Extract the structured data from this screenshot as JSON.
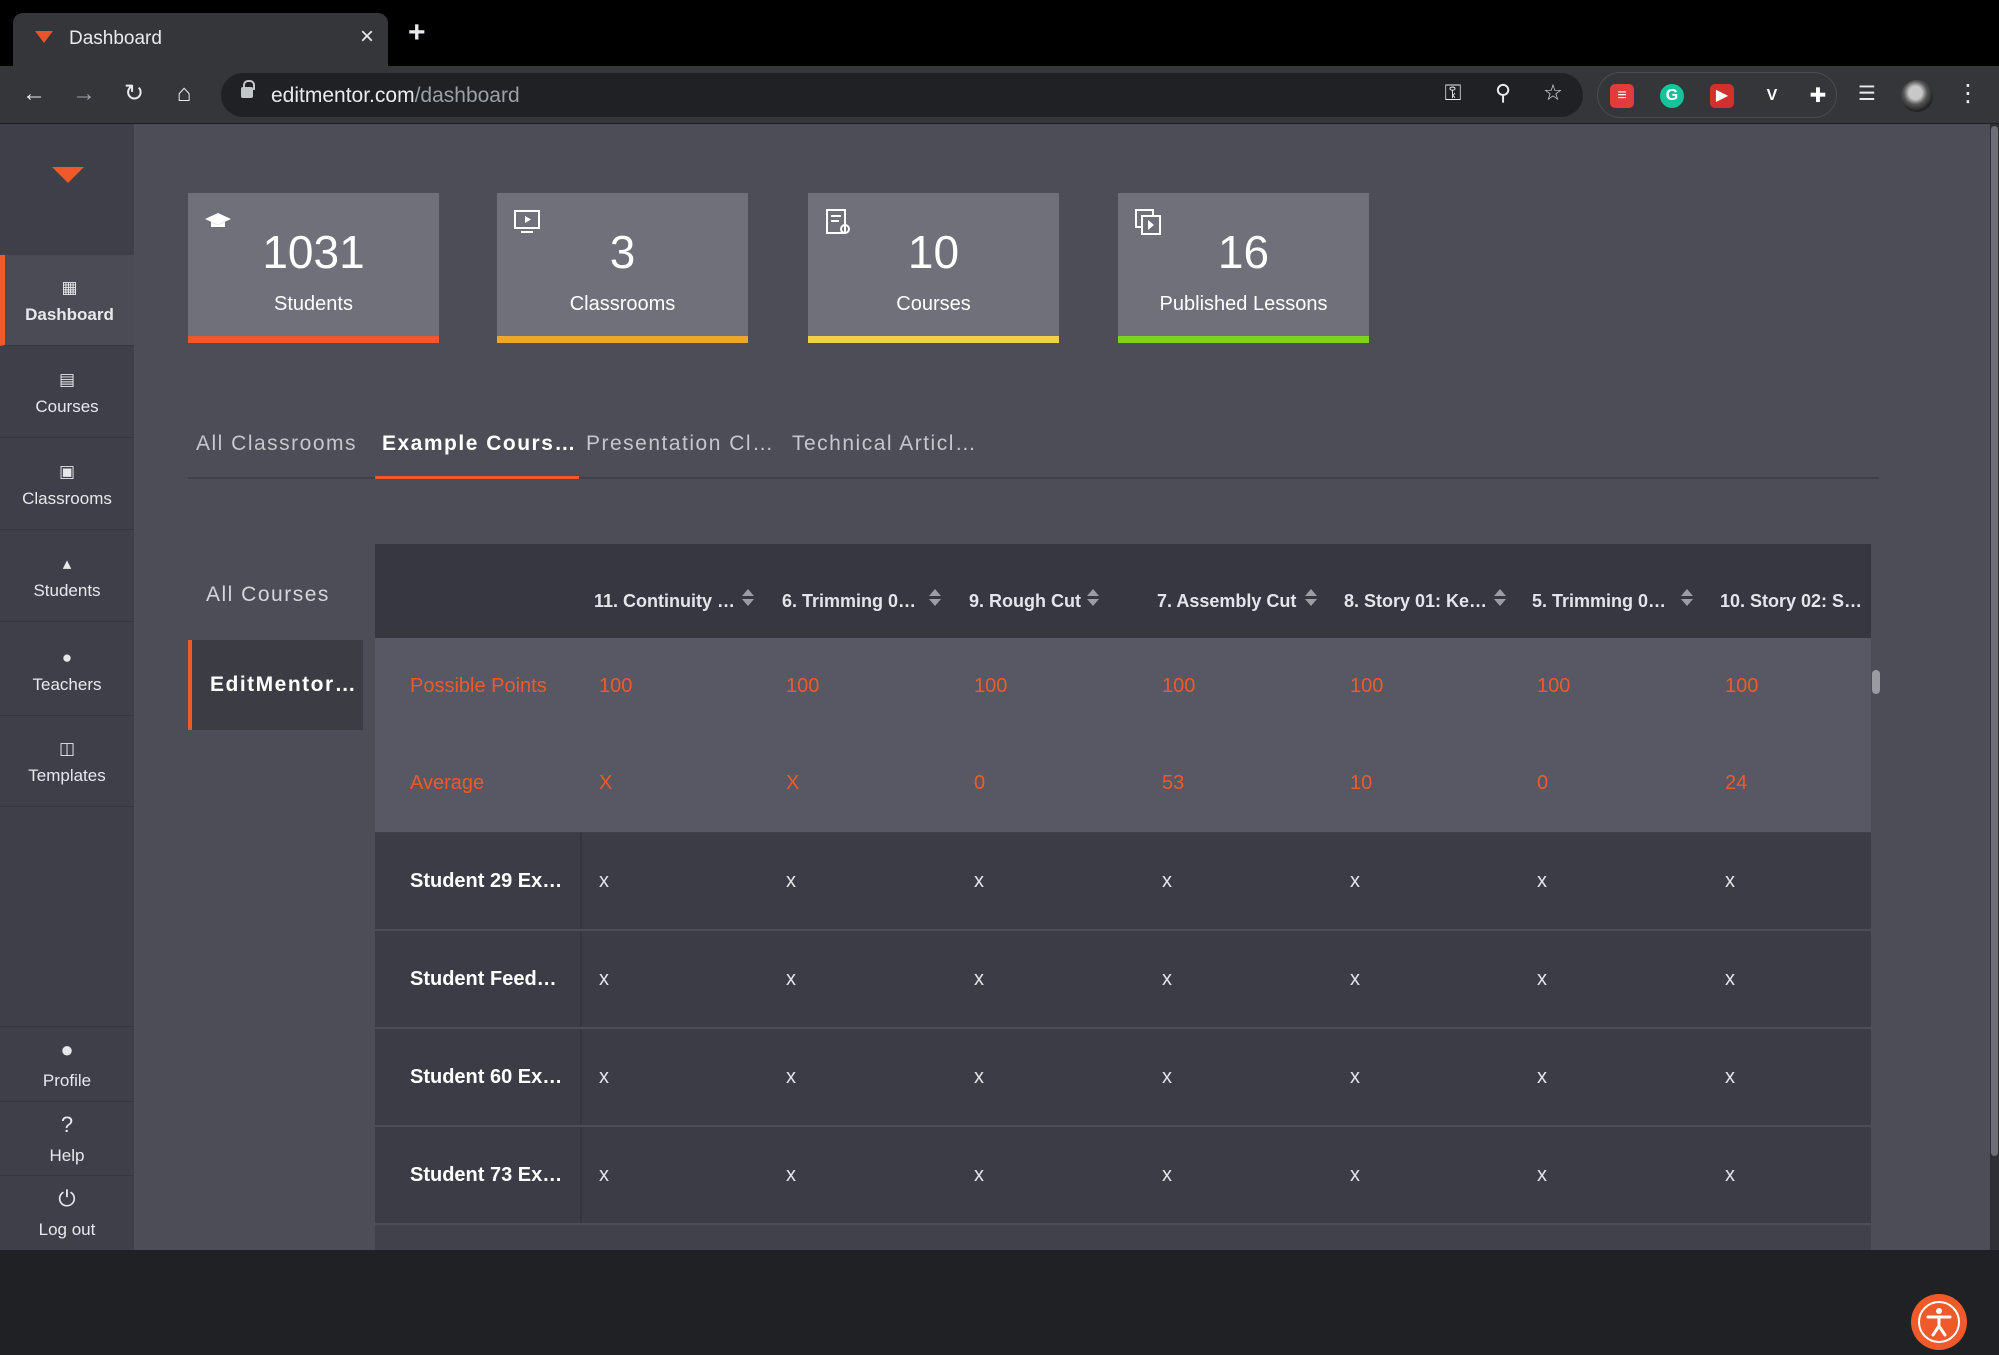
{
  "browser": {
    "tab_title": "Dashboard",
    "url_host": "editmentor.com",
    "url_path": "/dashboard",
    "accent": "#e8542c"
  },
  "sidebar": {
    "items": [
      {
        "label": "Dashboard",
        "icon": "dashboard-icon"
      },
      {
        "label": "Courses",
        "icon": "courses-icon"
      },
      {
        "label": "Classrooms",
        "icon": "classrooms-icon"
      },
      {
        "label": "Students",
        "icon": "students-icon"
      },
      {
        "label": "Teachers",
        "icon": "teachers-icon"
      },
      {
        "label": "Templates",
        "icon": "templates-icon"
      }
    ],
    "bottom": [
      {
        "label": "Profile",
        "icon": "profile-icon"
      },
      {
        "label": "Help",
        "icon": "help-icon"
      },
      {
        "label": "Log out",
        "icon": "power-icon"
      }
    ]
  },
  "stats": [
    {
      "value": "1031",
      "label": "Students",
      "color": "#f05a2b",
      "icon": "graduation-cap-icon"
    },
    {
      "value": "3",
      "label": "Classrooms",
      "color": "#f0a62b",
      "icon": "monitor-play-icon"
    },
    {
      "value": "10",
      "label": "Courses",
      "color": "#f0d24a",
      "icon": "certificate-icon"
    },
    {
      "value": "16",
      "label": "Published Lessons",
      "color": "#7ed321",
      "icon": "copy-play-icon"
    }
  ],
  "classroom_tabs": [
    "All Classrooms",
    "Example Cours…",
    "Presentation Cl…",
    "Technical Articl…"
  ],
  "courses": [
    "All Courses",
    "EditMentor…"
  ],
  "grid": {
    "columns": [
      "11. Continuity …",
      "6. Trimming 0…",
      "9. Rough Cut",
      "7. Assembly Cut",
      "8. Story 01: Ke…",
      "5. Trimming 0…",
      "10. Story 02: S…"
    ],
    "possible_points": {
      "label": "Possible Points",
      "values": [
        "100",
        "100",
        "100",
        "100",
        "100",
        "100",
        "100"
      ]
    },
    "average": {
      "label": "Average",
      "values": [
        "X",
        "X",
        "0",
        "53",
        "10",
        "0",
        "24"
      ]
    },
    "students": [
      {
        "name": "Student 29 Ex…",
        "values": [
          "x",
          "x",
          "x",
          "x",
          "x",
          "x",
          "x"
        ]
      },
      {
        "name": "Student Feed…",
        "values": [
          "x",
          "x",
          "x",
          "x",
          "x",
          "x",
          "x"
        ]
      },
      {
        "name": "Student 60 Ex…",
        "values": [
          "x",
          "x",
          "x",
          "x",
          "x",
          "x",
          "x"
        ]
      },
      {
        "name": "Student 73 Ex…",
        "values": [
          "x",
          "x",
          "x",
          "x",
          "x",
          "x",
          "x"
        ]
      }
    ]
  }
}
